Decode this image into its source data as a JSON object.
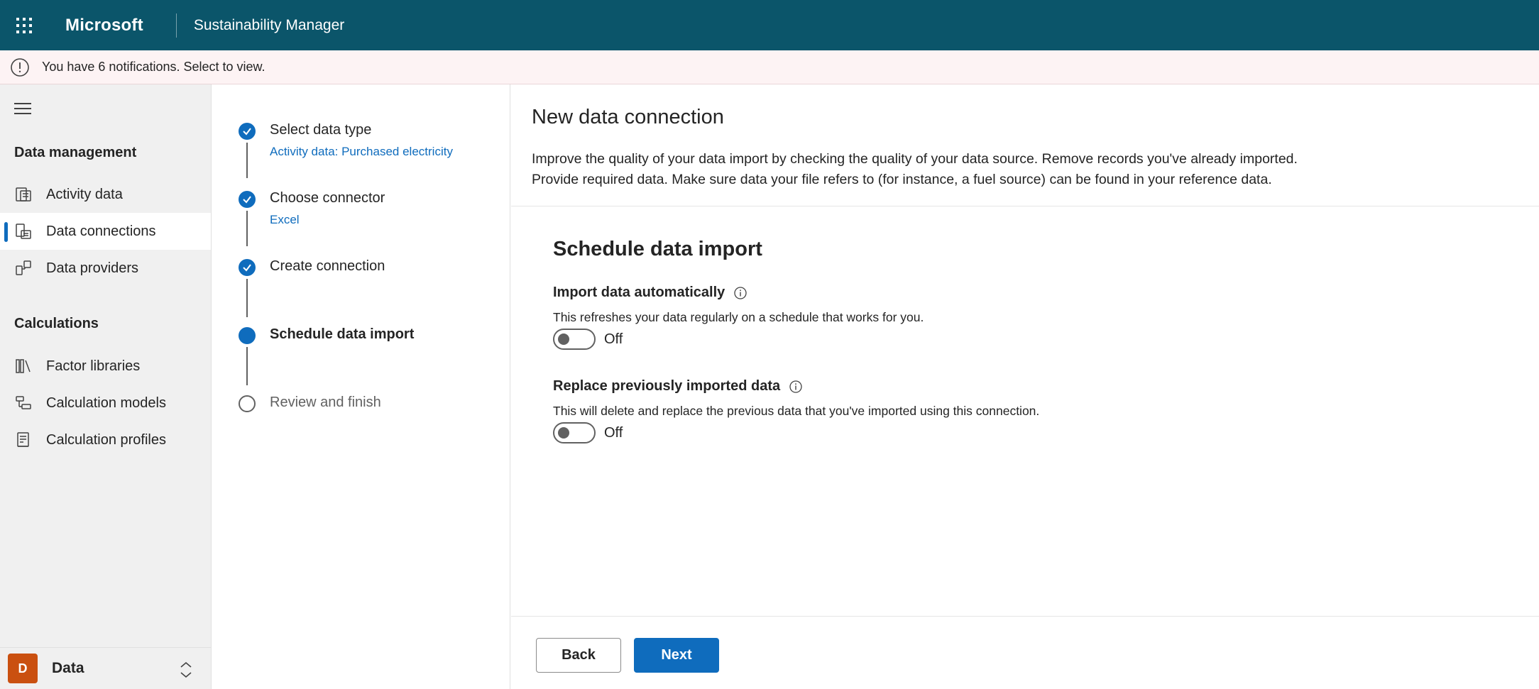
{
  "header": {
    "brand": "Microsoft",
    "app_name": "Sustainability Manager",
    "waffle_icon": "waffle-icon",
    "background_color": "#0b556a"
  },
  "notification": {
    "text": "You have 6 notifications. Select to view.",
    "icon": "warning-circle-icon"
  },
  "sidebar": {
    "menu_icon": "hamburger-icon",
    "sections": [
      {
        "title": "Data management",
        "items": [
          {
            "label": "Activity data",
            "icon": "activity-data-icon",
            "active": false
          },
          {
            "label": "Data connections",
            "icon": "data-connections-icon",
            "active": true
          },
          {
            "label": "Data providers",
            "icon": "data-providers-icon",
            "active": false
          }
        ]
      },
      {
        "title": "Calculations",
        "items": [
          {
            "label": "Factor libraries",
            "icon": "factor-libraries-icon",
            "active": false
          },
          {
            "label": "Calculation models",
            "icon": "calculation-models-icon",
            "active": false
          },
          {
            "label": "Calculation profiles",
            "icon": "calculation-profiles-icon",
            "active": false
          }
        ]
      }
    ],
    "environment": {
      "avatar_letter": "D",
      "label": "Data",
      "avatar_color": "#ca5010"
    }
  },
  "stepper": {
    "steps": [
      {
        "title": "Select data type",
        "subtitle": "Activity data: Purchased electricity",
        "state": "done"
      },
      {
        "title": "Choose connector",
        "subtitle": "Excel",
        "state": "done"
      },
      {
        "title": "Create connection",
        "subtitle": "",
        "state": "done"
      },
      {
        "title": "Schedule data import",
        "subtitle": "",
        "state": "current"
      },
      {
        "title": "Review and finish",
        "subtitle": "",
        "state": "todo"
      }
    ]
  },
  "main": {
    "title": "New data connection",
    "description_line1": "Improve the quality of your data import by checking the quality of your data source. Remove records you've already imported.",
    "description_line2": "Provide required data. Make sure data your file refers to (for instance, a fuel source) can be found in your reference data.",
    "section_title": "Schedule data import",
    "fields": [
      {
        "label": "Import data automatically",
        "help": "This refreshes your data regularly on a schedule that works for you.",
        "toggle_state": "Off"
      },
      {
        "label": "Replace previously imported data",
        "help": "This will delete and replace the previous data that you've imported using this connection.",
        "toggle_state": "Off"
      }
    ],
    "buttons": {
      "back": "Back",
      "next": "Next"
    },
    "accent_color": "#0f6cbd"
  }
}
